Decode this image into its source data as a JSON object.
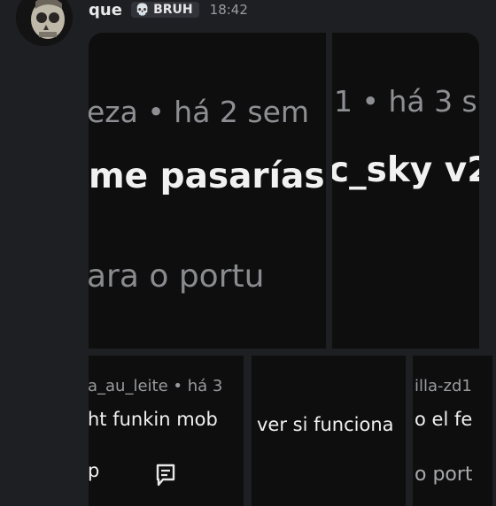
{
  "message": {
    "username": "que",
    "tag_icon": "skull-icon",
    "tag_label": "BRUH",
    "timestamp": "18:42"
  },
  "attachments": [
    {
      "meta": "eza • há 2 sem",
      "title": "me pasarías",
      "body": "ara o portu"
    },
    {
      "meta": "1 • há 3 s",
      "title": "c_sky v2"
    },
    {
      "meta": "a_au_leite • há 3",
      "title": "ht funkin mob",
      "body": "p",
      "icon": "comment-icon"
    },
    {
      "title": "ver si funciona"
    },
    {
      "meta": "illa-zd1",
      "title": "o el fe",
      "body": "o port"
    }
  ]
}
